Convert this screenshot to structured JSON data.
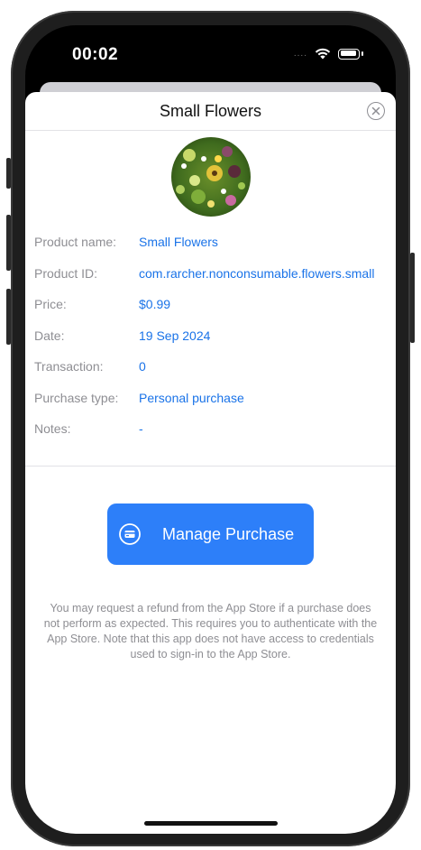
{
  "status_bar": {
    "time": "00:02",
    "signal": "....",
    "wifi_icon": "wifi-icon",
    "battery_icon": "battery-icon"
  },
  "sheet": {
    "title": "Small Flowers",
    "close_icon": "close-circle-icon"
  },
  "details": [
    {
      "label": "Product name:",
      "value": "Small Flowers"
    },
    {
      "label": "Product ID:",
      "value": "com.rarcher.nonconsumable.flowers.small"
    },
    {
      "label": "Price:",
      "value": "$0.99"
    },
    {
      "label": "Date:",
      "value": "19 Sep 2024"
    },
    {
      "label": "Transaction:",
      "value": "0"
    },
    {
      "label": "Purchase type:",
      "value": "Personal purchase"
    },
    {
      "label": "Notes:",
      "value": "-"
    }
  ],
  "manage_button": {
    "label": "Manage Purchase",
    "icon": "credit-card-icon"
  },
  "footnote": "You may request a refund from the App Store if a purchase does not perform as expected. This requires you to authenticate with the App Store. Note that this app does not have access to credentials used to sign-in to the App Store.",
  "colors": {
    "accent": "#2d7ff9",
    "link": "#1a73e8",
    "label": "#8e8e93"
  }
}
